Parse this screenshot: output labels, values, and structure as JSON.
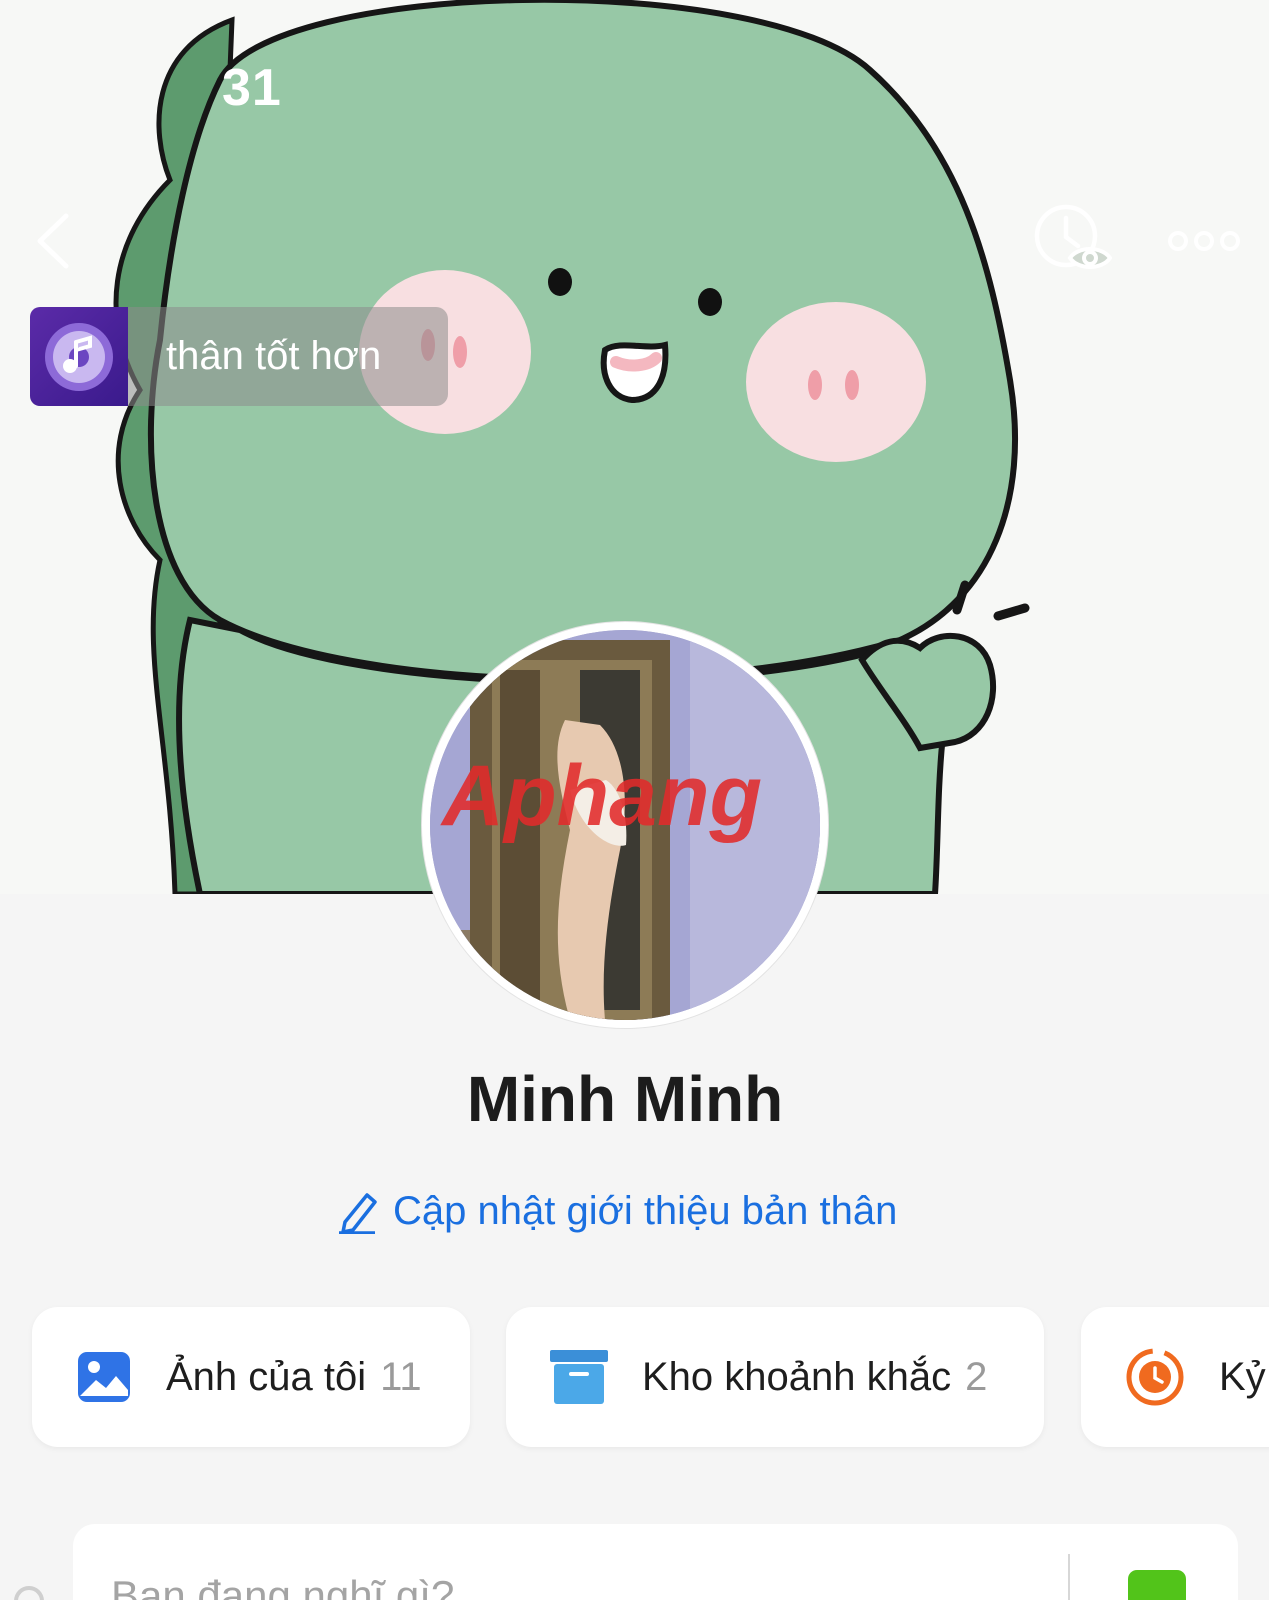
{
  "status_bar": {
    "time": "31"
  },
  "header": {
    "back_icon": "chevron-left-icon",
    "visit_icon": "clock-eye-icon",
    "more_icon": "more-dots-icon"
  },
  "music": {
    "icon": "music-disc-icon",
    "song": "thân tốt hơn"
  },
  "profile": {
    "name": "Minh Minh",
    "bio_action": "Cập nhật giới thiệu bản thân",
    "avatar_watermark": "Aphang"
  },
  "shortcuts": [
    {
      "icon": "image-icon",
      "label": "Ảnh của tôi",
      "count": "11"
    },
    {
      "icon": "archive-box-icon",
      "label": "Kho khoảnh khắc",
      "count": "2"
    },
    {
      "icon": "memory-clock-icon",
      "label": "Kỷ"
    }
  ],
  "composer": {
    "placeholder": "Bạn đang nghĩ gì?",
    "photo_icon": "photo-icon"
  },
  "colors": {
    "accent": "#1a6fe0",
    "cover_green": "#97c8a6",
    "cheek_pink": "#f8dfe1",
    "music_purple": "#4b2399",
    "archive_blue": "#4ba8e8",
    "memory_orange": "#f06a1f",
    "composer_green": "#52c41a"
  }
}
